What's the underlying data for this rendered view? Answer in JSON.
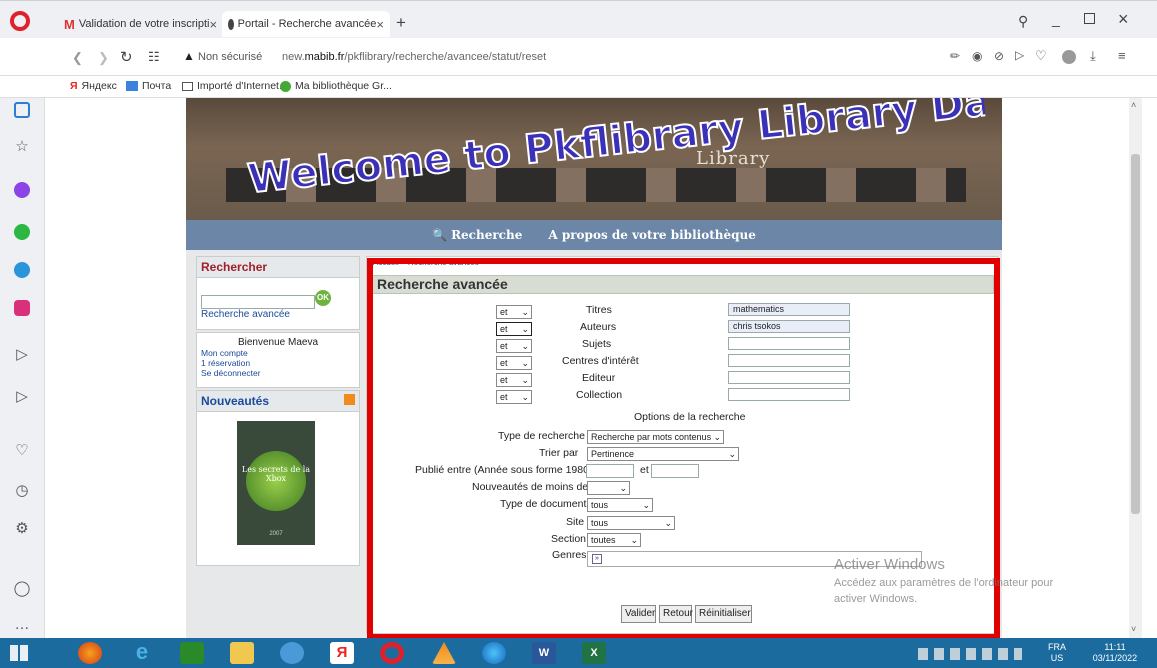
{
  "browser": {
    "tabs": [
      {
        "label": "Validation de votre inscripti"
      },
      {
        "label": "Portail - Recherche avancée"
      }
    ],
    "security": "Non sécurisé",
    "url_prefix": "new.",
    "url_domain": "mabib.fr",
    "url_path": "/pkflibrary/recherche/avancee/statut/reset",
    "bookmarks": [
      "Яндекс",
      "Почта",
      "Importé d'Internet...",
      "Ma bibliothèque Gr..."
    ]
  },
  "site": {
    "banner_title": "Welcome to Pkflibrary Library Database",
    "banner_library": "Library",
    "nav": {
      "search": "Recherche",
      "about": "A propos de votre bibliothèque"
    },
    "left": {
      "search_title": "Rechercher",
      "ok": "OK",
      "advanced_link": "Recherche avancée",
      "welcome": "Bienvenue Maeva",
      "account": "Mon compte",
      "reservation": "1 réservation",
      "logout": "Se déconnecter",
      "news_title": "Nouveautés",
      "book_title": "Les secrets de la Xbox",
      "book_year": "2007"
    },
    "main": {
      "breadcrumb": "Accueil > Recherche avancée",
      "title": "Recherche avancée",
      "rows": [
        {
          "op": "et",
          "label": "Titres",
          "value": "mathematics"
        },
        {
          "op": "et",
          "label": "Auteurs",
          "value": "chris tsokos"
        },
        {
          "op": "et",
          "label": "Sujets",
          "value": ""
        },
        {
          "op": "et",
          "label": "Centres d'intérêt",
          "value": ""
        },
        {
          "op": "et",
          "label": "Editeur",
          "value": ""
        },
        {
          "op": "et",
          "label": "Collection",
          "value": ""
        }
      ],
      "options_title": "Options de la recherche",
      "search_type_label": "Type de recherche",
      "search_type_value": "Recherche par mots contenus",
      "sort_label": "Trier par",
      "sort_value": "Pertinence",
      "published_label": "Publié entre (Année sous forme 1980)",
      "and_label": "et",
      "news_label": "Nouveautés de moins de",
      "doc_type_label": "Type de document",
      "doc_type_value": "tous",
      "site_label": "Site",
      "site_value": "tous",
      "section_label": "Section",
      "section_value": "toutes",
      "genres_label": "Genres",
      "validate": "Valider",
      "back": "Retour",
      "reset": "Réinitialiser"
    },
    "watermark": {
      "title": "Activer Windows",
      "line1": "Accédez aux paramètres de l'ordinateur pour",
      "line2": "activer Windows."
    }
  },
  "taskbar": {
    "lang": "FRA",
    "lang2": "US",
    "time": "11:11",
    "date": "03/11/2022"
  },
  "colors": {
    "highlight": "#e00000",
    "nav_bar": "#6b86a6",
    "header_bg": "#d8ddd4"
  }
}
